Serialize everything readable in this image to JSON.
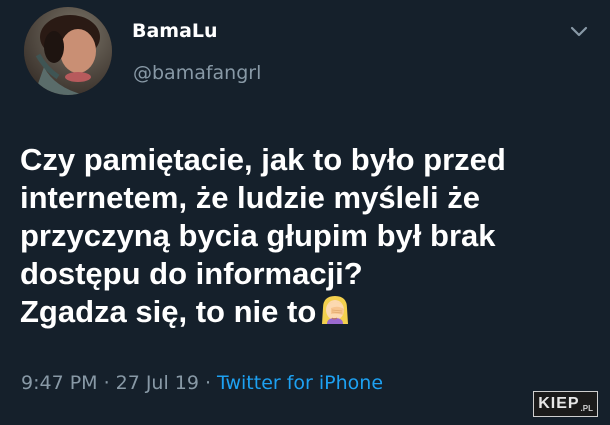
{
  "tweet": {
    "display_name": "BamaLu",
    "handle": "@bamafangrl",
    "text_lines": [
      "Czy pamiętacie, jak to było przed",
      "internetem, że ludzie myśleli że",
      "przyczyną bycia głupim był brak",
      "dostępu do informacji?",
      "Zgadza się, to nie to"
    ],
    "emoji": "face-palm-woman-emoji",
    "time": "9:47 PM",
    "date": "27 Jul 19",
    "separator": "·",
    "source": "Twitter for iPhone"
  },
  "icons": {
    "more_menu": "chevron-down-icon"
  },
  "watermark": {
    "main": "KIEP",
    "suffix": ".PL"
  },
  "colors": {
    "background": "#15202b",
    "text": "#ffffff",
    "secondary": "#8899a6",
    "link": "#1da1f2"
  }
}
